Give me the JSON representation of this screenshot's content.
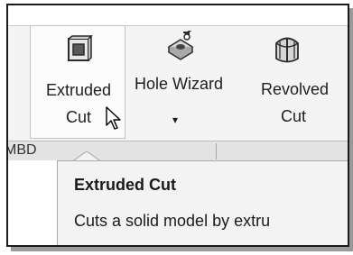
{
  "ribbon": {
    "tools": [
      {
        "id": "extruded-cut",
        "label_line1": "Extruded",
        "label_line2": "Cut",
        "icon": "extruded-cut-icon"
      },
      {
        "id": "hole-wizard",
        "label_line1": "Hole Wizard",
        "label_line2": "",
        "icon": "hole-wizard-icon",
        "has_dropdown": true
      },
      {
        "id": "revolved-cut",
        "label_line1": "Revolved",
        "label_line2": "Cut",
        "icon": "revolved-cut-icon"
      }
    ],
    "dropdown_caret": "▾"
  },
  "tabs": {
    "left_label": "MBD",
    "right_label": ""
  },
  "tooltip": {
    "title": "Extruded Cut",
    "description": "Cuts a solid model by extru"
  },
  "colors": {
    "frame_border": "#1a1a1a",
    "ribbon_bg": "#f4f4f4",
    "tooltip_bg": "#f3f3f3"
  }
}
